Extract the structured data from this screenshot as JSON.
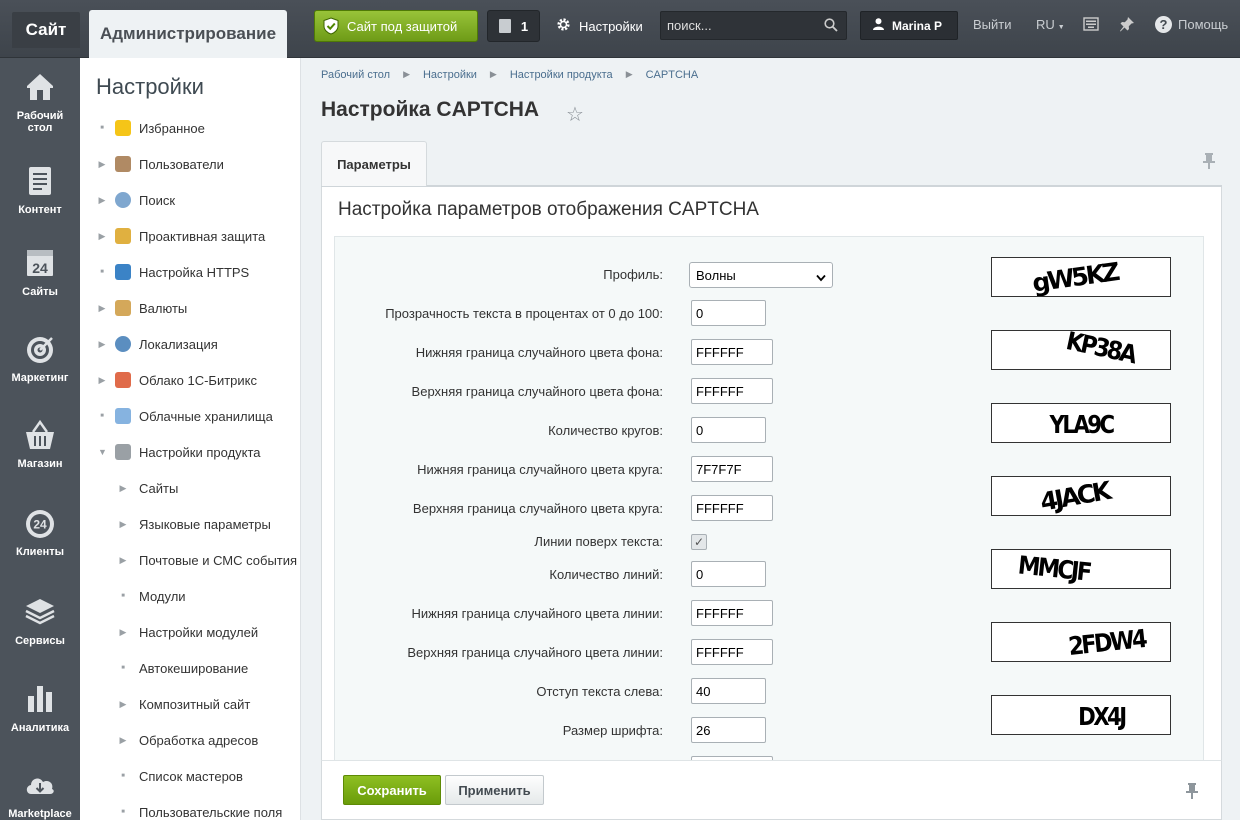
{
  "topbar": {
    "site_label": "Сайт",
    "admin_label": "Администрирование",
    "secure_label": "Сайт под защитой",
    "notifications_count": "1",
    "settings_label": "Настройки",
    "search_placeholder": "поиск...",
    "user_name": "Marina P",
    "logout_label": "Выйти",
    "lang_label": "RU",
    "help_label": "Помощь",
    "icons": [
      "shield-icon",
      "notification-icon",
      "gear-icon",
      "search-icon",
      "user-icon",
      "keyboard-icon",
      "pin-icon",
      "help-icon"
    ]
  },
  "leftmenu": {
    "items": [
      {
        "label1": "Рабочий",
        "label2": "стол",
        "icon": "home-icon"
      },
      {
        "label1": "Контент",
        "label2": "",
        "icon": "document-icon"
      },
      {
        "label1": "Сайты",
        "label2": "",
        "icon": "calendar-24-icon"
      },
      {
        "label1": "Маркетинг",
        "label2": "",
        "icon": "target-icon"
      },
      {
        "label1": "Магазин",
        "label2": "",
        "icon": "basket-icon"
      },
      {
        "label1": "Клиенты",
        "label2": "",
        "icon": "clients-24-icon"
      },
      {
        "label1": "Сервисы",
        "label2": "",
        "icon": "layers-icon"
      },
      {
        "label1": "Аналитика",
        "label2": "",
        "icon": "bar-chart-icon"
      },
      {
        "label1": "Marketplace",
        "label2": "",
        "icon": "cloud-download-icon"
      }
    ]
  },
  "sidebar": {
    "title": "Настройки",
    "items": [
      {
        "label": "Избранное",
        "marker": "dot",
        "icon": "star-icon"
      },
      {
        "label": "Пользователи",
        "marker": "arrow",
        "icon": "user-icon"
      },
      {
        "label": "Поиск",
        "marker": "arrow",
        "icon": "magnifier-icon"
      },
      {
        "label": "Проактивная защита",
        "marker": "arrow",
        "icon": "lock-icon"
      },
      {
        "label": "Настройка HTTPS",
        "marker": "dot",
        "icon": "https-lock-icon"
      },
      {
        "label": "Валюты",
        "marker": "arrow",
        "icon": "currency-icon"
      },
      {
        "label": "Локализация",
        "marker": "arrow",
        "icon": "globe-icon"
      },
      {
        "label": "Облако 1С-Битрикс",
        "marker": "arrow",
        "icon": "cloud-icon"
      },
      {
        "label": "Облачные хранилища",
        "marker": "dot",
        "icon": "storage-icon"
      },
      {
        "label": "Настройки продукта",
        "marker": "down",
        "icon": "gear-icon"
      }
    ],
    "subitems": [
      {
        "label": "Сайты",
        "marker": "arrow"
      },
      {
        "label": "Языковые параметры",
        "marker": "arrow"
      },
      {
        "label": "Почтовые и СМС события",
        "marker": "arrow"
      },
      {
        "label": "Модули",
        "marker": "dot"
      },
      {
        "label": "Настройки модулей",
        "marker": "arrow"
      },
      {
        "label": "Автокеширование",
        "marker": "dot"
      },
      {
        "label": "Композитный сайт",
        "marker": "arrow"
      },
      {
        "label": "Обработка адресов",
        "marker": "arrow"
      },
      {
        "label": "Список мастеров",
        "marker": "dot"
      },
      {
        "label": "Пользовательские поля",
        "marker": "dot"
      }
    ]
  },
  "breadcrumb": [
    "Рабочий стол",
    "Настройки",
    "Настройки продукта",
    "CAPTCHA"
  ],
  "page_title": "Настройка CAPTCHA",
  "tab_label": "Параметры",
  "panel_title": "Настройка параметров отображения CAPTCHA",
  "form": {
    "profile_label": "Профиль:",
    "profile_value": "Волны",
    "fields": [
      {
        "label": "Прозрачность текста в процентах от 0 до 100:",
        "value": "0"
      },
      {
        "label": "Нижняя граница случайного цвета фона:",
        "value": "FFFFFF"
      },
      {
        "label": "Верхняя граница случайного цвета фона:",
        "value": "FFFFFF"
      },
      {
        "label": "Количество кругов:",
        "value": "0"
      },
      {
        "label": "Нижняя граница случайного цвета круга:",
        "value": "7F7F7F"
      },
      {
        "label": "Верхняя граница случайного цвета круга:",
        "value": "FFFFFF"
      },
      {
        "label": "Линии поверх текста:",
        "value": "checked"
      },
      {
        "label": "Количество линий:",
        "value": "0"
      },
      {
        "label": "Нижняя граница случайного цвета линии:",
        "value": "FFFFFF"
      },
      {
        "label": "Верхняя граница случайного цвета линии:",
        "value": "FFFFFF"
      },
      {
        "label": "Отступ текста слева:",
        "value": "40"
      },
      {
        "label": "Размер шрифта:",
        "value": "26"
      }
    ],
    "captchas": [
      "gW5KZ",
      "KP38A",
      "YLA9C",
      "4JACK",
      "MMCJF",
      "2FDW4",
      "DX4J"
    ]
  },
  "footer": {
    "save_label": "Сохранить",
    "apply_label": "Применить"
  },
  "colors": {
    "topbar": "#434950",
    "leftmenu": "#4c535b",
    "save_green": "#7aac15",
    "secure_green": "#86b42a",
    "link_blue": "#4a6e8e"
  }
}
